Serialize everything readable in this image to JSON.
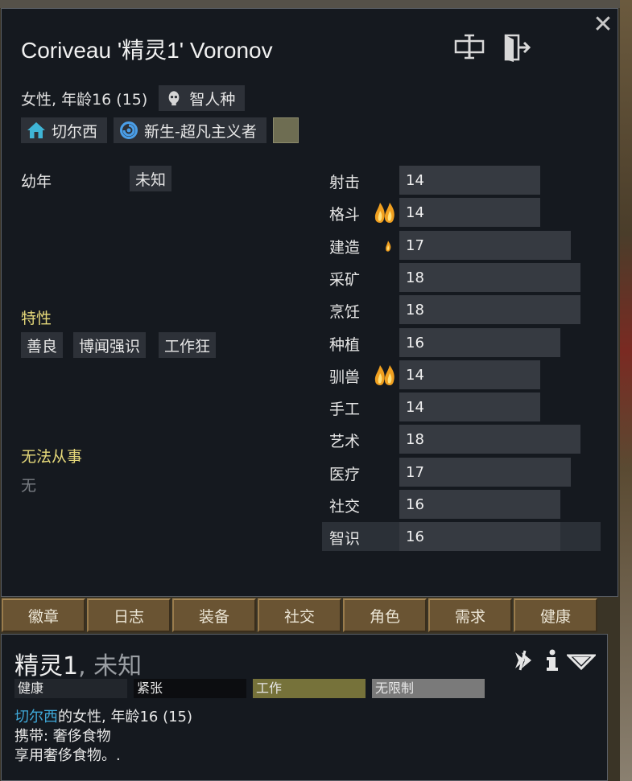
{
  "colors": {
    "panel_bg": "#15191f",
    "chip_bg": "#2d3138",
    "skill_bar": "#363a41",
    "gold_label": "#e6d97a",
    "link": "#3fa9d9",
    "tab_bg": "#6a5433",
    "work_sched": "#76723a",
    "unrestricted_sched": "#7a7a7a"
  },
  "header": {
    "name": "Coriveau '精灵1' Voronov",
    "rename_icon": "rename-icon",
    "banish_icon": "banish-door-icon",
    "close_icon": "close-icon"
  },
  "identity": {
    "gender_age": "女性, 年龄16 (15)",
    "xenotype": "智人种"
  },
  "chips": {
    "faction": "切尔西",
    "ideology": "新生-超凡主义者",
    "favorite_color": "#6e6d52"
  },
  "backstory": {
    "childhood_label": "幼年",
    "childhood_value": "未知"
  },
  "traits": {
    "label": "特性",
    "items": [
      "善良",
      "博闻强识",
      "工作狂"
    ]
  },
  "incapable": {
    "label": "无法从事",
    "value": "无"
  },
  "skills": [
    {
      "name": "射击",
      "level": 14,
      "passion": "none"
    },
    {
      "name": "格斗",
      "level": 14,
      "passion": "major"
    },
    {
      "name": "建造",
      "level": 17,
      "passion": "minor"
    },
    {
      "name": "采矿",
      "level": 18,
      "passion": "none"
    },
    {
      "name": "烹饪",
      "level": 18,
      "passion": "none"
    },
    {
      "name": "种植",
      "level": 16,
      "passion": "none"
    },
    {
      "name": "驯兽",
      "level": 14,
      "passion": "major"
    },
    {
      "name": "手工",
      "level": 14,
      "passion": "none"
    },
    {
      "name": "艺术",
      "level": 18,
      "passion": "none"
    },
    {
      "name": "医疗",
      "level": 17,
      "passion": "none"
    },
    {
      "name": "社交",
      "level": 16,
      "passion": "none"
    },
    {
      "name": "智识",
      "level": 16,
      "passion": "none",
      "highlighted": true
    }
  ],
  "tabs": [
    "徽章",
    "日志",
    "装备",
    "社交",
    "角色",
    "需求",
    "健康"
  ],
  "inspect": {
    "name": "精灵1",
    "title_suffix": ", 未知",
    "schedule": [
      "健康",
      "紧张",
      "工作",
      "无限制"
    ],
    "desc_faction": "切尔西",
    "desc_rest": "的女性, 年龄16 (15)",
    "carrying": "携带: 奢侈食物",
    "activity": "享用奢侈食物。."
  }
}
